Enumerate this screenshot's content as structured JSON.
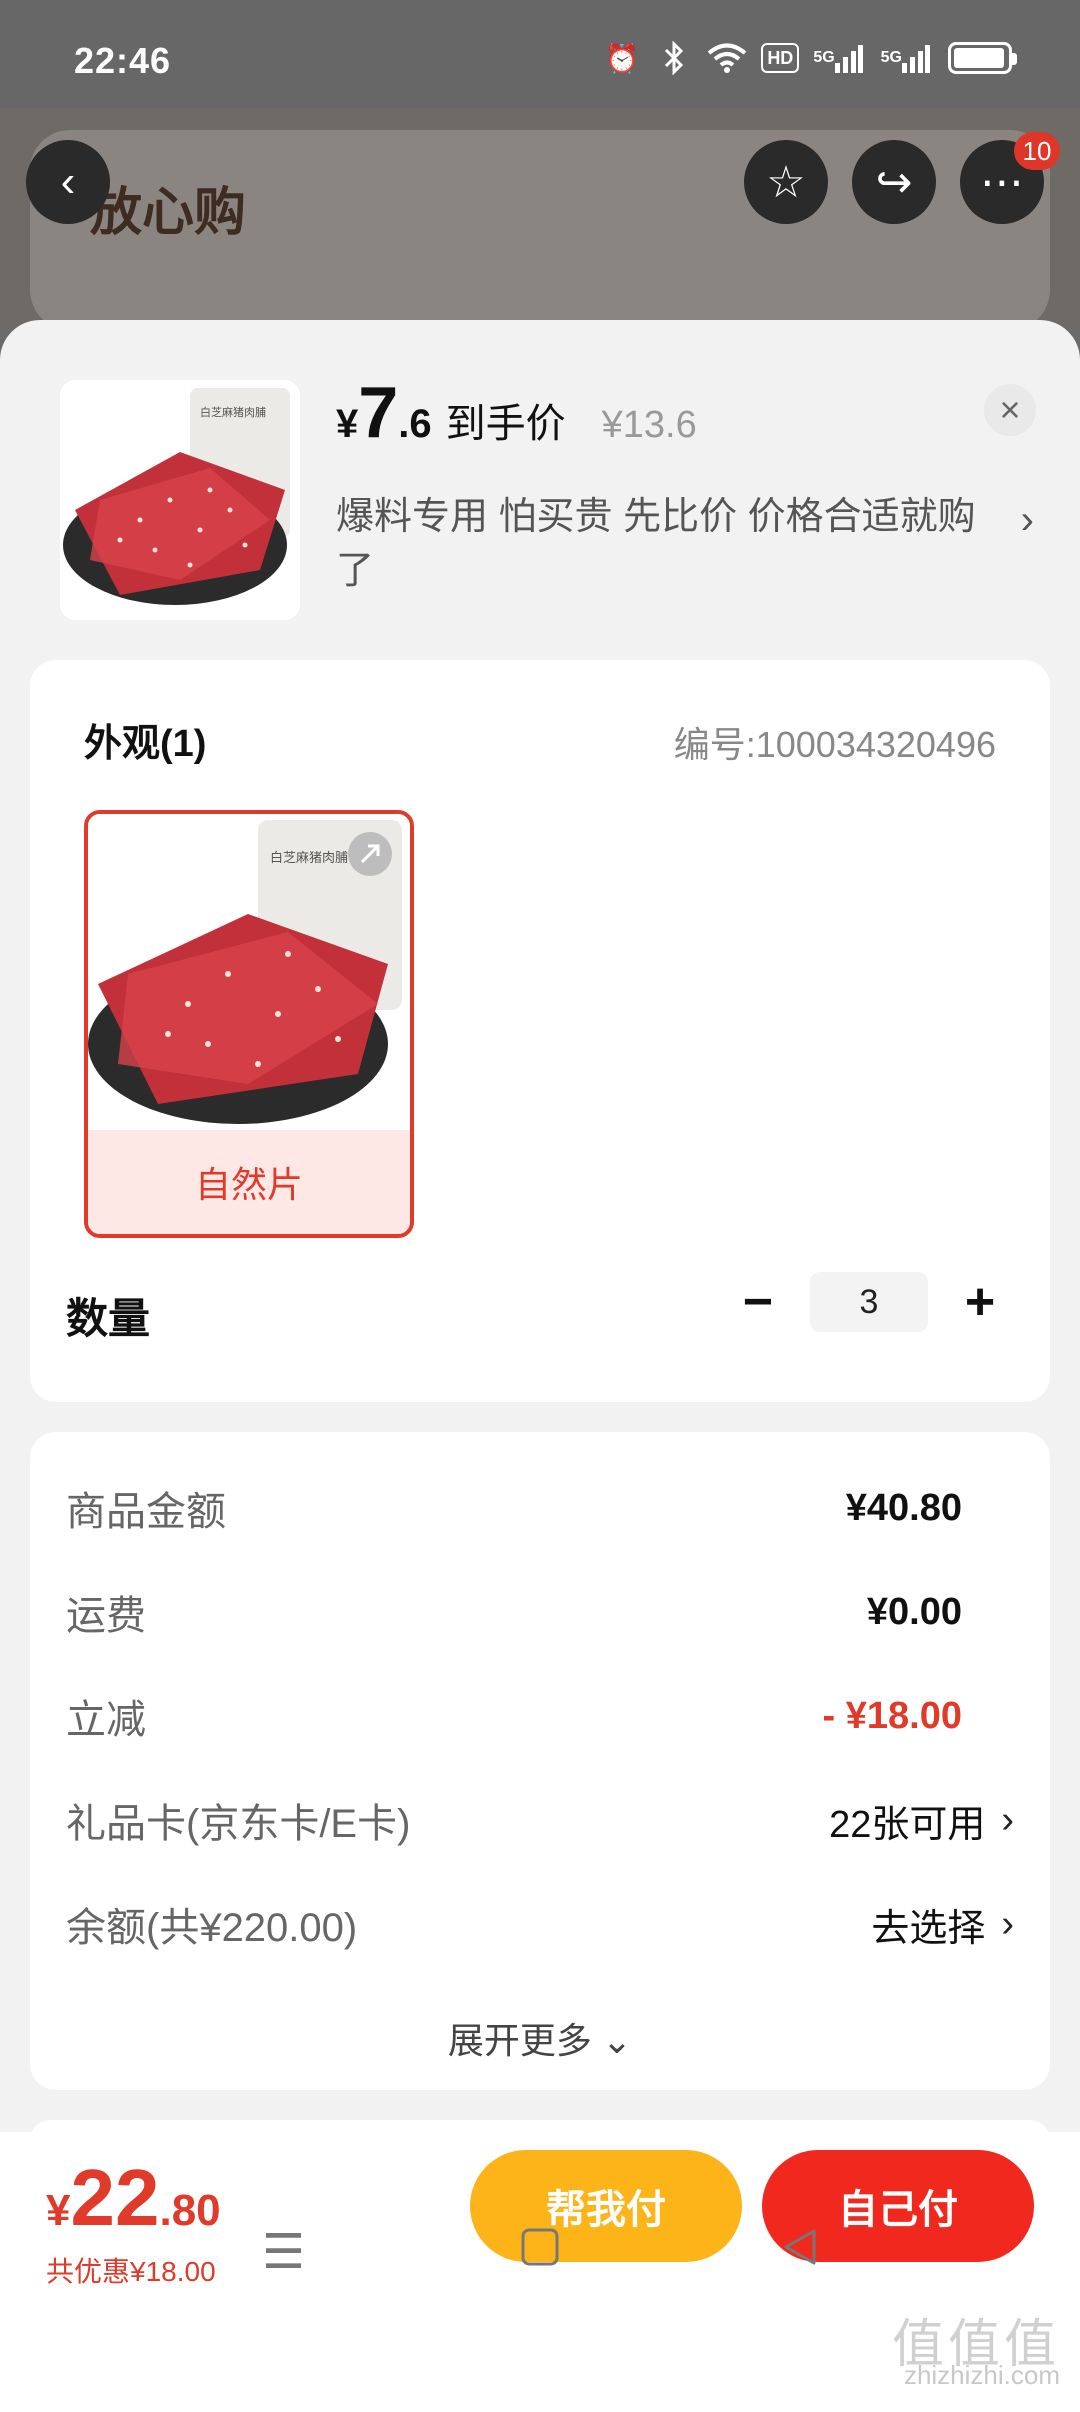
{
  "status_bar": {
    "time": "22:46",
    "icons": [
      "alarm-icon",
      "bluetooth-icon",
      "wifi-icon",
      "hd-icon",
      "signal-5g-icon",
      "signal-5g-icon",
      "battery-icon"
    ],
    "hd_label": "HD",
    "net1": "5G",
    "net2": "5G"
  },
  "background_page": {
    "title": "放心购",
    "more_badge": "10"
  },
  "product": {
    "price_yen": "¥",
    "price_int": "7",
    "price_dec": ".6",
    "price_tag": "到手价",
    "original_price": "¥13.6",
    "description": "爆料专用 怕买贵 先比价 价格合适就购了",
    "close_icon": "×",
    "image_text": "白芝麻猪肉脯"
  },
  "appearance": {
    "title": "外观(1)",
    "sku_number": "编号:100034320496",
    "option_label": "自然片"
  },
  "quantity": {
    "label": "数量",
    "minus": "−",
    "value": "3",
    "plus": "+"
  },
  "cost": {
    "rows": [
      {
        "label": "商品金额",
        "value": "¥40.80"
      },
      {
        "label": "运费",
        "value": "¥0.00"
      },
      {
        "label": "立减",
        "value": "- ¥18.00"
      },
      {
        "label": "礼品卡(京东卡/E卡)",
        "value": "22张可用"
      },
      {
        "label": "余额(共¥220.00)",
        "value": "去选择"
      }
    ],
    "expand_more": "展开更多 ⌄"
  },
  "bottom": {
    "total_yen": "¥",
    "total_int": "22",
    "total_dec": ".80",
    "discount": "共优惠¥18.00",
    "help_pay": "帮我付",
    "self_pay": "自己付"
  },
  "watermark": {
    "big": "值值值",
    "small": "zhizhizhi.com"
  },
  "colors": {
    "accent_red": "#e03a2a",
    "help_yellow": "#fcb418",
    "self_red": "#f0281e"
  }
}
